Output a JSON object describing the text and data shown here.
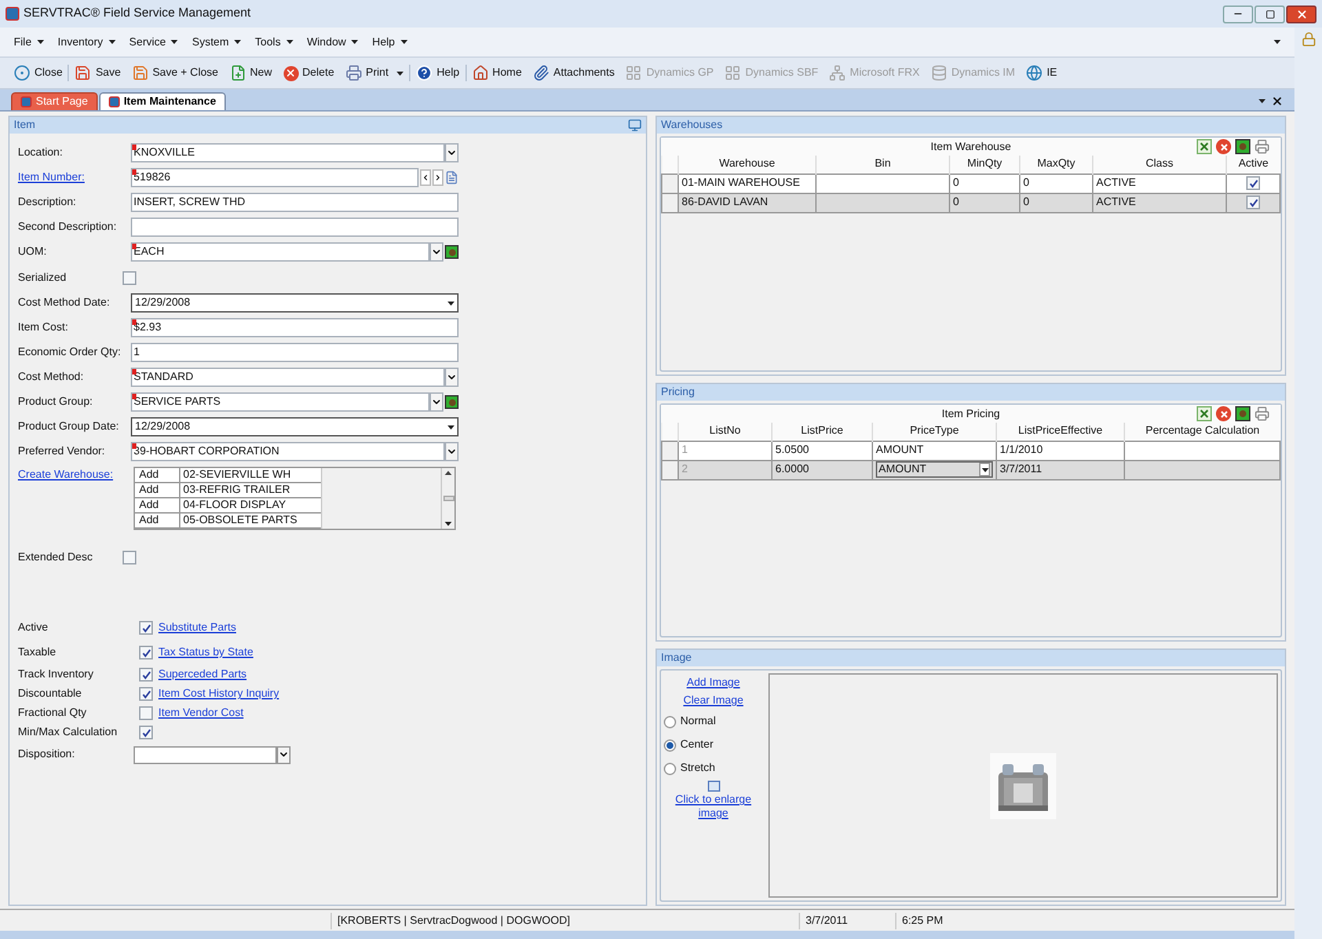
{
  "window": {
    "title": "SERVTRAC® Field Service Management"
  },
  "menu": [
    {
      "label": "File"
    },
    {
      "label": "Inventory"
    },
    {
      "label": "Service"
    },
    {
      "label": "System"
    },
    {
      "label": "Tools"
    },
    {
      "label": "Window"
    },
    {
      "label": "Help"
    }
  ],
  "toolbar": [
    [
      {
        "label": "Close",
        "disabled": false
      }
    ],
    [
      {
        "label": "Save",
        "disabled": false
      },
      {
        "label": "Save + Close",
        "disabled": false
      },
      {
        "label": "New",
        "disabled": false
      },
      {
        "label": "Delete",
        "disabled": false
      },
      {
        "label": "Print",
        "disabled": false,
        "dropdown": true
      }
    ],
    [
      {
        "label": "Help",
        "disabled": false
      }
    ],
    [
      {
        "label": "Home",
        "disabled": false
      },
      {
        "label": "Attachments",
        "disabled": false
      },
      {
        "label": "Dynamics GP",
        "disabled": true
      },
      {
        "label": "Dynamics SBF",
        "disabled": true
      },
      {
        "label": "Microsoft FRX",
        "disabled": true
      },
      {
        "label": "Dynamics IM",
        "disabled": true
      },
      {
        "label": "IE",
        "disabled": false
      }
    ]
  ],
  "tabs": [
    {
      "label": "Start Page",
      "selected": false
    },
    {
      "label": "Item Maintenance",
      "selected": true
    }
  ],
  "item_panel": {
    "title": "Item",
    "fields": [
      {
        "kind": "combo",
        "label": "Location:",
        "value": "KNOXVILLE",
        "required": true
      },
      {
        "kind": "nav",
        "label": "Item Number:",
        "link": true,
        "value": "519826",
        "required": true
      },
      {
        "kind": "text",
        "label": "Description:",
        "value": "INSERT, SCREW THD"
      },
      {
        "kind": "text",
        "label": "Second Description:"
      },
      {
        "kind": "combo_add",
        "label": "UOM:",
        "value": "EACH",
        "required": true
      },
      {
        "kind": "checkbox",
        "label": "Serialized",
        "checked": false
      },
      {
        "kind": "date",
        "label": "Cost Method Date:",
        "value": "12/29/2008"
      },
      {
        "kind": "text",
        "label": "Item Cost:",
        "value": "$2.93",
        "required": true
      },
      {
        "kind": "text",
        "label": "Economic Order Qty:",
        "value": "1"
      },
      {
        "kind": "combo",
        "label": "Cost Method:",
        "value": "STANDARD",
        "required": true
      },
      {
        "kind": "combo_add",
        "label": "Product Group:",
        "value": "SERVICE PARTS",
        "required": true
      },
      {
        "kind": "date",
        "label": "Product Group Date:",
        "value": "12/29/2008"
      },
      {
        "kind": "combo",
        "label": "Preferred Vendor:",
        "value": "39-HOBART CORPORATION",
        "required": true
      },
      {
        "kind": "list",
        "label": "Create Warehouse:",
        "link": true,
        "rows": [
          {
            "action": "Add",
            "name": "02-SEVIERVILLE WH"
          },
          {
            "action": "Add",
            "name": "03-REFRIG TRAILER"
          },
          {
            "action": "Add",
            "name": "04-FLOOR DISPLAY"
          },
          {
            "action": "Add",
            "name": "05-OBSOLETE PARTS"
          }
        ]
      },
      {
        "kind": "checkbox",
        "label": "Extended Desc",
        "checked": false
      }
    ],
    "flags": [
      {
        "label": "Active",
        "checked": true,
        "link": "Substitute Parts"
      },
      {
        "label": "Taxable",
        "checked": true,
        "link": "Tax Status by State"
      },
      {
        "label": "Track Inventory",
        "checked": true,
        "link": "Superceded Parts"
      },
      {
        "label": "Discountable",
        "checked": true,
        "link": "Item Cost History Inquiry"
      },
      {
        "label": "Fractional Qty",
        "checked": false,
        "link": "Item Vendor Cost"
      },
      {
        "label": "Min/Max Calculation",
        "checked": true
      }
    ],
    "disposition": {
      "label": "Disposition:"
    }
  },
  "warehouses": {
    "title": "Warehouses",
    "grid_title": "Item Warehouse",
    "columns": [
      "Warehouse",
      "Bin",
      "MinQty",
      "MaxQty",
      "Class",
      "Active"
    ],
    "rows": [
      {
        "selected": false,
        "cells": [
          "01-MAIN WAREHOUSE",
          "",
          "0",
          "0",
          "ACTIVE"
        ],
        "active": true
      },
      {
        "selected": true,
        "cells": [
          "86-DAVID LAVAN",
          "",
          "0",
          "0",
          "ACTIVE"
        ],
        "active": true
      }
    ]
  },
  "pricing": {
    "title": "Pricing",
    "grid_title": "Item Pricing",
    "columns": [
      "ListNo",
      "ListPrice",
      "PriceType",
      "ListPriceEffective",
      "Percentage Calculation"
    ],
    "rows": [
      {
        "selected": false,
        "cells": [
          "1",
          "5.0500",
          "AMOUNT",
          "1/1/2010",
          ""
        ]
      },
      {
        "selected": true,
        "cells": [
          "2",
          "6.0000",
          "AMOUNT",
          "3/7/2011",
          ""
        ]
      }
    ]
  },
  "image_panel": {
    "title": "Image",
    "links": [
      "Add Image",
      "Clear Image"
    ],
    "modes": [
      {
        "label": "Normal",
        "selected": false
      },
      {
        "label": "Center",
        "selected": true
      },
      {
        "label": "Stretch",
        "selected": false
      }
    ],
    "enlarge_link": "Click to enlarge image"
  },
  "status_bar": {
    "session": "[KROBERTS | ServtracDogwood | DOGWOOD]",
    "date": "3/7/2011",
    "time": "6:25 PM"
  }
}
